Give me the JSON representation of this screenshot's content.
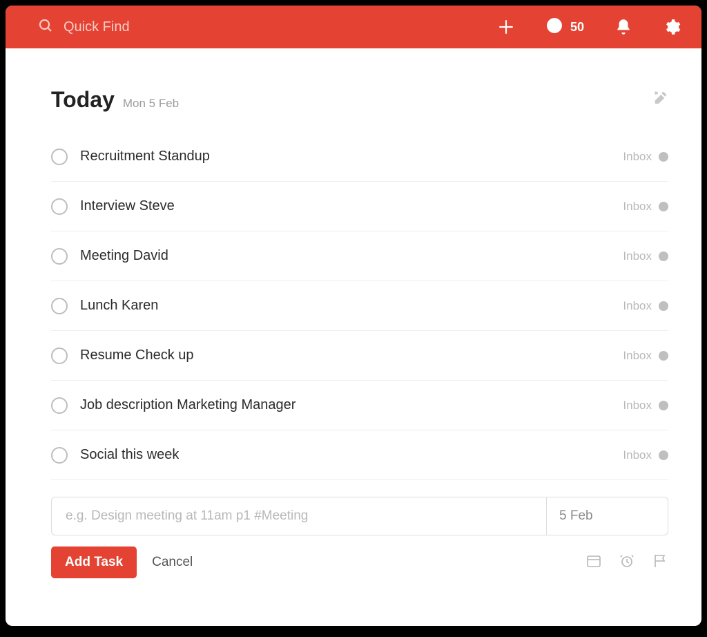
{
  "header": {
    "search_placeholder": "Quick Find",
    "karma_count": "50"
  },
  "page": {
    "title": "Today",
    "date": "Mon 5 Feb"
  },
  "tasks": [
    {
      "title": "Recruitment Standup",
      "project": "Inbox"
    },
    {
      "title": "Interview Steve",
      "project": "Inbox"
    },
    {
      "title": "Meeting David",
      "project": "Inbox"
    },
    {
      "title": "Lunch Karen",
      "project": "Inbox"
    },
    {
      "title": "Resume Check up",
      "project": "Inbox"
    },
    {
      "title": "Job description Marketing Manager",
      "project": "Inbox"
    },
    {
      "title": "Social this week",
      "project": "Inbox"
    }
  ],
  "add_form": {
    "placeholder": "e.g. Design meeting at 11am p1 #Meeting",
    "date_value": "5 Feb",
    "add_label": "Add Task",
    "cancel_label": "Cancel"
  }
}
